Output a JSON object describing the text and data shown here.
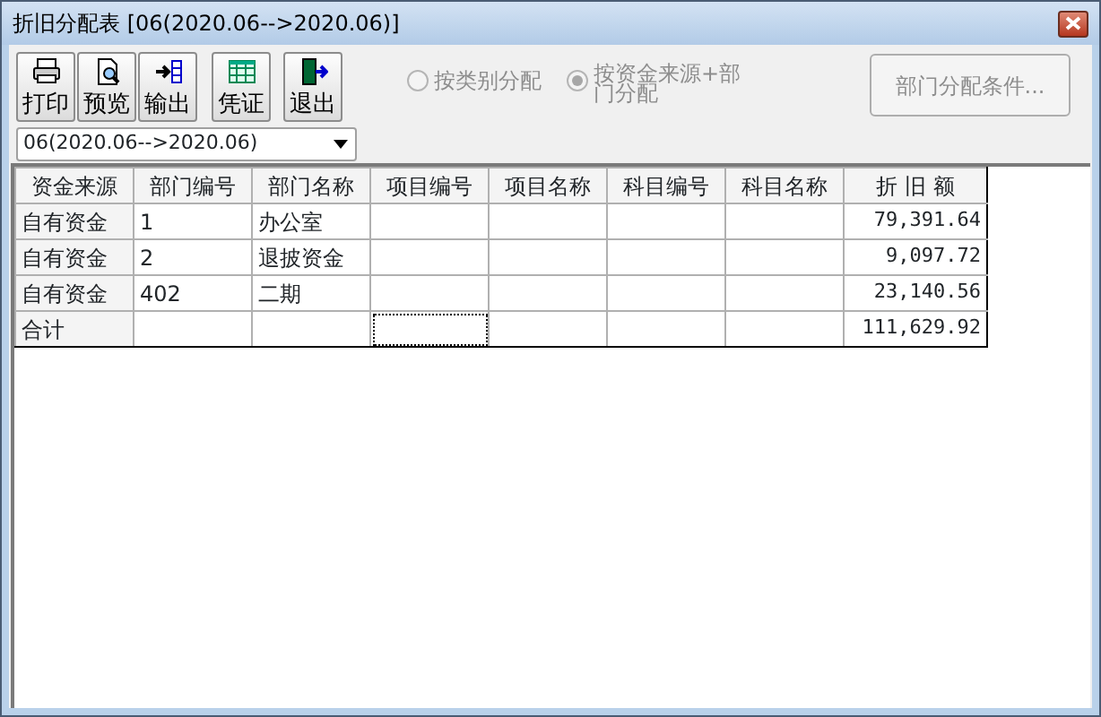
{
  "window": {
    "title": "折旧分配表 [06(2020.06-->2020.06)]"
  },
  "toolbar": [
    {
      "label": "打印",
      "kind": "print"
    },
    {
      "label": "预览",
      "kind": "preview"
    },
    {
      "label": "输出",
      "kind": "export"
    },
    {
      "label": "凭证",
      "kind": "voucher"
    },
    {
      "label": "退出",
      "kind": "exit"
    }
  ],
  "period_select": {
    "value": "06(2020.06-->2020.06)"
  },
  "allocation_options": [
    {
      "label": "按类别分配",
      "selected": false,
      "disabled": true
    },
    {
      "label": "按资金来源+部门分配",
      "selected": true,
      "disabled": true
    }
  ],
  "dept_condition_button": {
    "label": "部门分配条件...",
    "disabled": true
  },
  "table": {
    "columns": [
      "资金来源",
      "部门编号",
      "部门名称",
      "项目编号",
      "项目名称",
      "科目编号",
      "科目名称",
      "折 旧 额"
    ],
    "rows": [
      {
        "cells": [
          {
            "text": "自有资金"
          },
          {
            "text": "1"
          },
          {
            "text": "办公室"
          },
          {},
          {},
          {},
          {},
          {
            "text": "79,391.64"
          }
        ]
      },
      {
        "cells": [
          {
            "text": "自有资金"
          },
          {
            "text": "2"
          },
          {
            "text": "退披资金"
          },
          {},
          {},
          {},
          {},
          {
            "text": "9,097.72"
          }
        ]
      },
      {
        "cells": [
          {
            "text": "自有资金"
          },
          {
            "text": "402"
          },
          {
            "text": "二期"
          },
          {},
          {},
          {},
          {},
          {
            "text": "23,140.56"
          }
        ]
      },
      {
        "cells": [
          {
            "text": "合计"
          },
          {},
          {},
          {
            "focused": true
          },
          {},
          {},
          {},
          {
            "text": "111,629.92"
          }
        ]
      }
    ]
  }
}
